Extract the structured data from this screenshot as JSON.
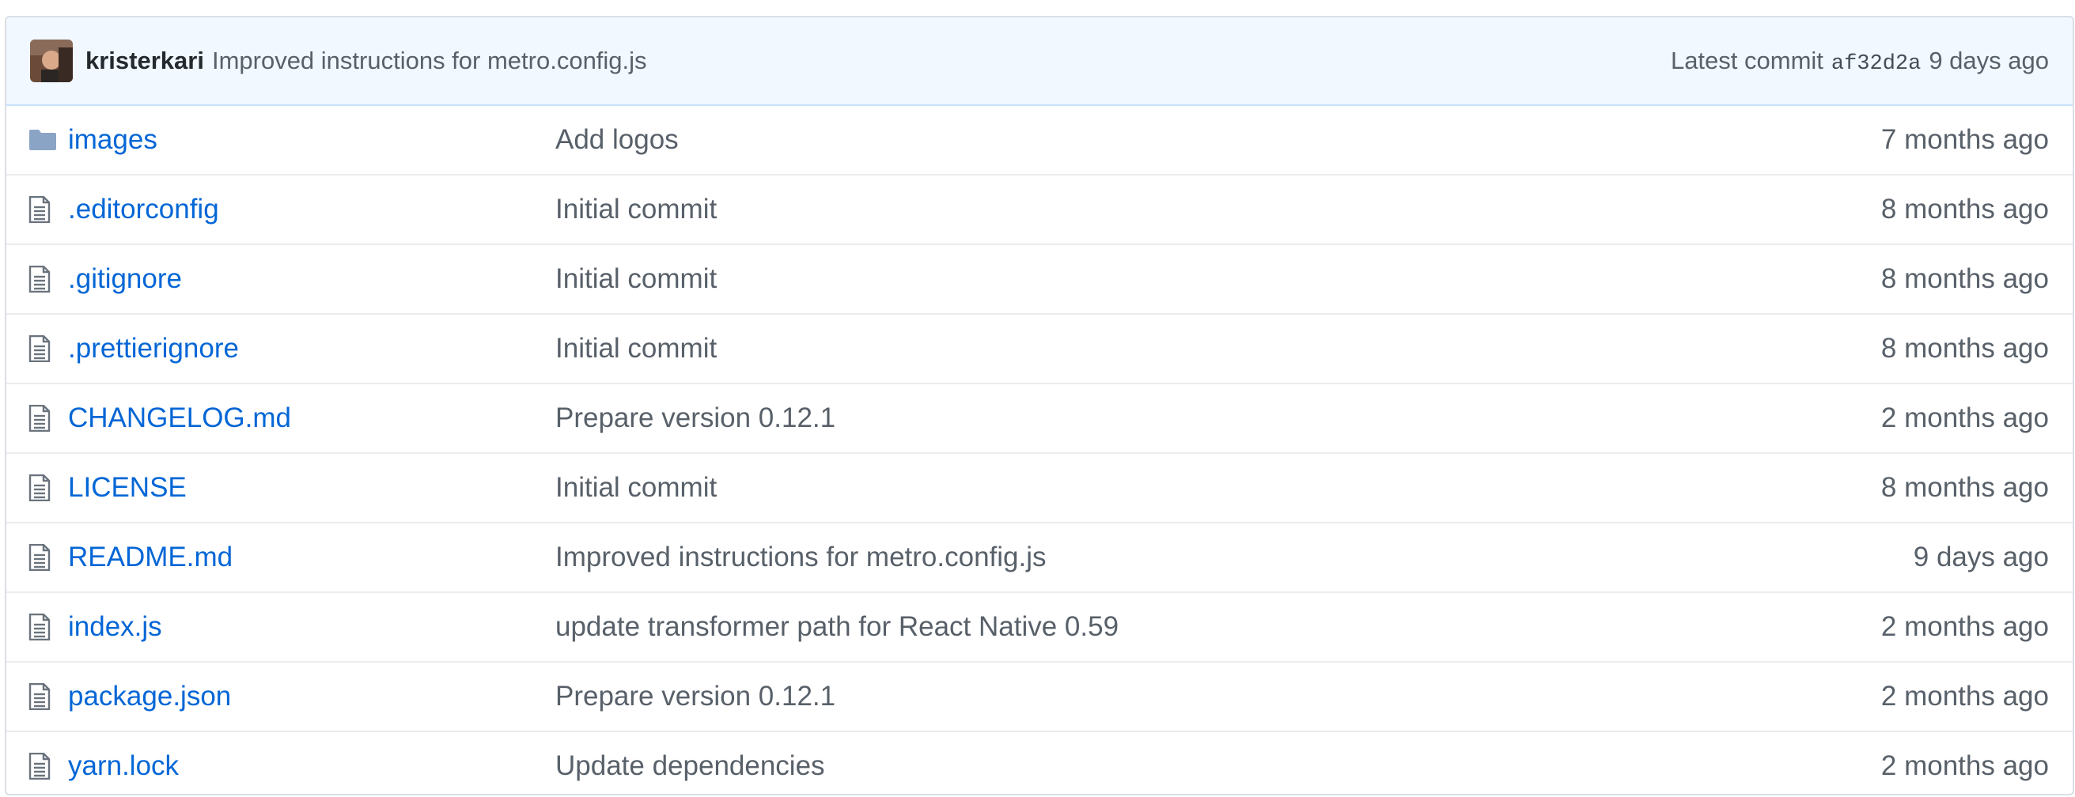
{
  "commit": {
    "author": "kristerkari",
    "message": "Improved instructions for metro.config.js",
    "latest_label": "Latest commit",
    "sha": "af32d2a",
    "age": "9 days ago"
  },
  "files": [
    {
      "icon": "folder-icon",
      "name": "images",
      "message": "Add logos",
      "age": "7 months ago"
    },
    {
      "icon": "file-icon",
      "name": ".editorconfig",
      "message": "Initial commit",
      "age": "8 months ago"
    },
    {
      "icon": "file-icon",
      "name": ".gitignore",
      "message": "Initial commit",
      "age": "8 months ago"
    },
    {
      "icon": "file-icon",
      "name": ".prettierignore",
      "message": "Initial commit",
      "age": "8 months ago"
    },
    {
      "icon": "file-icon",
      "name": "CHANGELOG.md",
      "message": "Prepare version 0.12.1",
      "age": "2 months ago"
    },
    {
      "icon": "file-icon",
      "name": "LICENSE",
      "message": "Initial commit",
      "age": "8 months ago"
    },
    {
      "icon": "file-icon",
      "name": "README.md",
      "message": "Improved instructions for metro.config.js",
      "age": "9 days ago"
    },
    {
      "icon": "file-icon",
      "name": "index.js",
      "message": "update transformer path for React Native 0.59",
      "age": "2 months ago"
    },
    {
      "icon": "file-icon",
      "name": "package.json",
      "message": "Prepare version 0.12.1",
      "age": "2 months ago"
    },
    {
      "icon": "file-icon",
      "name": "yarn.lock",
      "message": "Update dependencies",
      "age": "2 months ago"
    }
  ],
  "colors": {
    "link": "#0366d6",
    "muted": "#586069",
    "header_bg": "#f1f8ff",
    "folder_icon": "#79b8ff"
  }
}
